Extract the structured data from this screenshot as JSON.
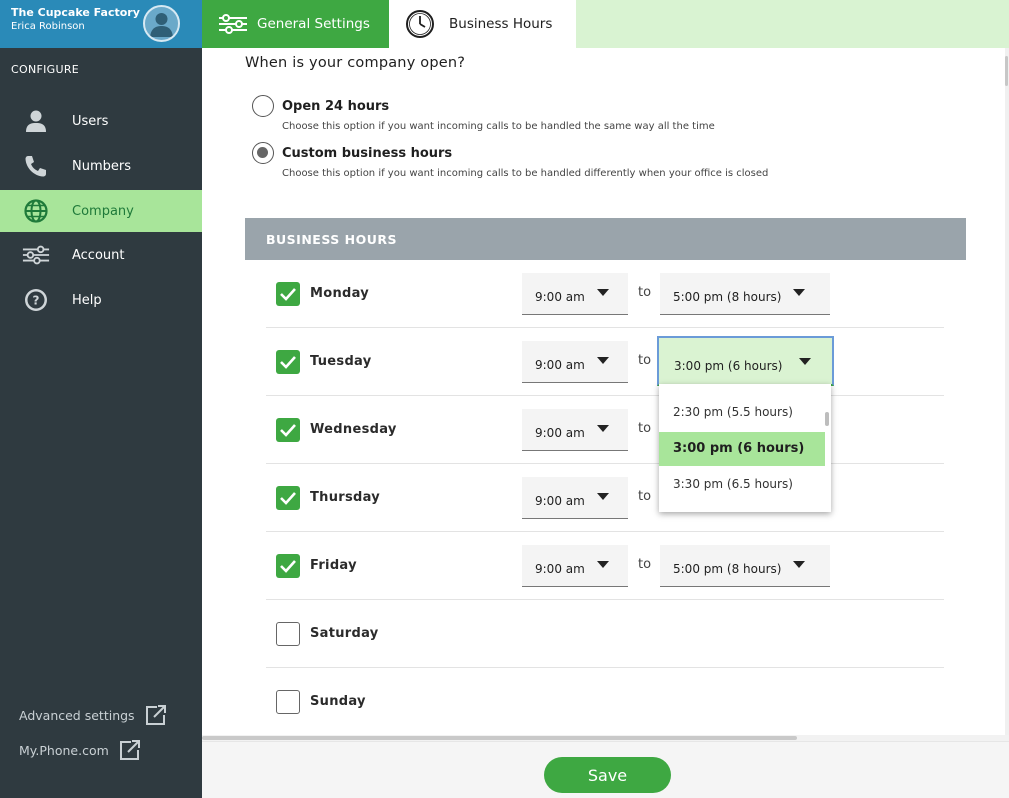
{
  "account": {
    "company": "The Cupcake Factory",
    "user": "Erica Robinson"
  },
  "sidebar": {
    "section": "CONFIGURE",
    "items": [
      {
        "label": "Users",
        "icon": "user-icon"
      },
      {
        "label": "Numbers",
        "icon": "phone-icon"
      },
      {
        "label": "Company",
        "icon": "globe-icon",
        "active": true
      },
      {
        "label": "Account",
        "icon": "sliders-icon"
      },
      {
        "label": "Help",
        "icon": "help-icon"
      }
    ],
    "footer": [
      {
        "label": "Advanced settings",
        "icon": "external-link-icon"
      },
      {
        "label": "My.Phone.com",
        "icon": "external-link-icon"
      }
    ]
  },
  "tabs": [
    {
      "label": "General Settings",
      "icon": "sliders-icon"
    },
    {
      "label": "Business Hours",
      "icon": "clock-icon",
      "active": true
    }
  ],
  "open_question": "When is your company open?",
  "options": [
    {
      "title": "Open 24 hours",
      "desc": "Choose this option if you want incoming calls to be handled the same way all the time",
      "selected": false
    },
    {
      "title": "Custom business hours",
      "desc": "Choose this option if you want incoming calls to be handled differently when your office is closed",
      "selected": true
    }
  ],
  "business_hours": {
    "header": "BUSINESS HOURS",
    "to_label": "to",
    "days": [
      {
        "day": "Monday",
        "enabled": true,
        "start": "9:00 am",
        "end": "5:00 pm (8 hours)"
      },
      {
        "day": "Tuesday",
        "enabled": true,
        "start": "9:00 am",
        "end": "3:00 pm (6 hours)"
      },
      {
        "day": "Wednesday",
        "enabled": true,
        "start": "9:00 am",
        "end": ""
      },
      {
        "day": "Thursday",
        "enabled": true,
        "start": "9:00 am",
        "end": ""
      },
      {
        "day": "Friday",
        "enabled": true,
        "start": "9:00 am",
        "end": "5:00 pm (8 hours)"
      },
      {
        "day": "Saturday",
        "enabled": false
      },
      {
        "day": "Sunday",
        "enabled": false
      }
    ],
    "dropdown_options": [
      "2:30 pm (5.5 hours)",
      "3:00 pm (6 hours)",
      "3:30 pm (6.5 hours)"
    ],
    "dropdown_selected": "3:00 pm (6 hours)"
  },
  "save_label": "Save",
  "colors": {
    "brand_green": "#3ea842",
    "light_green": "#a8e59a",
    "sidebar_bg": "#2f3a40",
    "header_blue": "#2a8ab8"
  }
}
